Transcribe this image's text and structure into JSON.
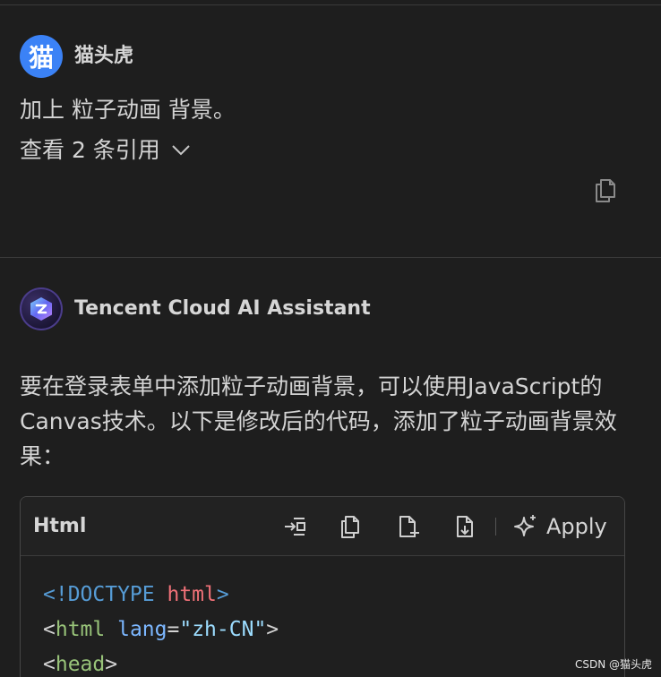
{
  "user": {
    "avatar_char": "猫",
    "name": "猫头虎",
    "message": "加上 粒子动画 背景。",
    "references_label": "查看 2 条引用",
    "copy_icon": "copy-icon",
    "avatar_color": "#3b82f6"
  },
  "assistant": {
    "name": "Tencent Cloud AI Assistant",
    "message": "要在登录表单中添加粒子动画背景，可以使用JavaScript的Canvas技术。以下是修改后的代码，添加了粒子动画背景效果：",
    "avatar_icon": "tencent-ai-logo-icon"
  },
  "code_block": {
    "language": "Html",
    "toolbar": [
      "insert-icon",
      "copy-icon",
      "new-file-icon",
      "save-to-file-icon"
    ],
    "apply_label": "Apply",
    "lines": [
      [
        {
          "t": "<!DOCTYPE ",
          "c": "c-doctype"
        },
        {
          "t": "html",
          "c": "c-kw"
        },
        {
          "t": ">",
          "c": "c-doctype"
        }
      ],
      [
        {
          "t": "<",
          "c": "c-punc"
        },
        {
          "t": "html",
          "c": "c-tag"
        },
        {
          "t": " lang",
          "c": "c-attr"
        },
        {
          "t": "=",
          "c": "c-punc"
        },
        {
          "t": "\"zh-CN\"",
          "c": "c-str"
        },
        {
          "t": ">",
          "c": "c-punc"
        }
      ],
      [
        {
          "t": "<",
          "c": "c-punc"
        },
        {
          "t": "head",
          "c": "c-tag"
        },
        {
          "t": ">",
          "c": "c-punc"
        }
      ]
    ]
  },
  "watermark": "CSDN @猫头虎",
  "colors": {
    "background": "#1e1e1e",
    "divider": "#3a3a3a",
    "text": "#d4d4d4"
  }
}
